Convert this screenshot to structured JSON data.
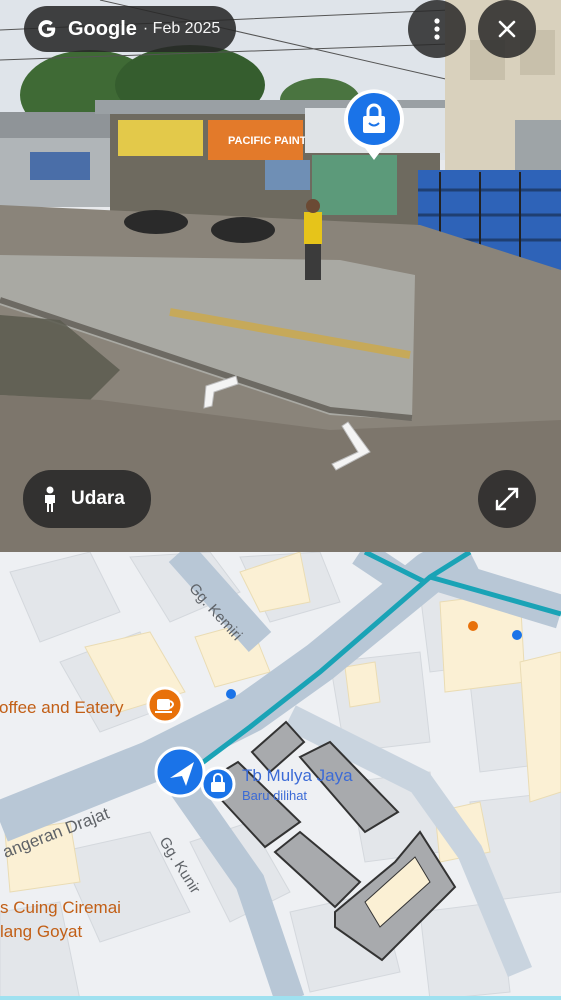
{
  "header": {
    "brand": "Google",
    "date": "· Feb 2025"
  },
  "controls": {
    "more_icon": "more-vert-icon",
    "close_icon": "close-icon",
    "expand_icon": "expand-icon",
    "mode_label": "Udara",
    "mode_icon": "person-icon"
  },
  "street_marker": {
    "icon": "shopping-bag-icon",
    "color": "#1a73e8"
  },
  "street_signs": [
    "PACIFIC PAINT"
  ],
  "map": {
    "labels": {
      "coffee": "offee and Eatery",
      "kemiri": "Gg. Kemiri",
      "drajat": "angeran Drajat",
      "kunir": "Gg. Kunir",
      "cuing": "s Cuing Ciremai",
      "goyat": "lang Goyat",
      "place_name": "Tb Mulya Jaya",
      "place_sub": "Baru dilihat"
    },
    "colors": {
      "road_fill": "#b8c7d6",
      "route": "#1aa3b6",
      "marker": "#1a73e8",
      "poi": "#e8710a"
    }
  }
}
